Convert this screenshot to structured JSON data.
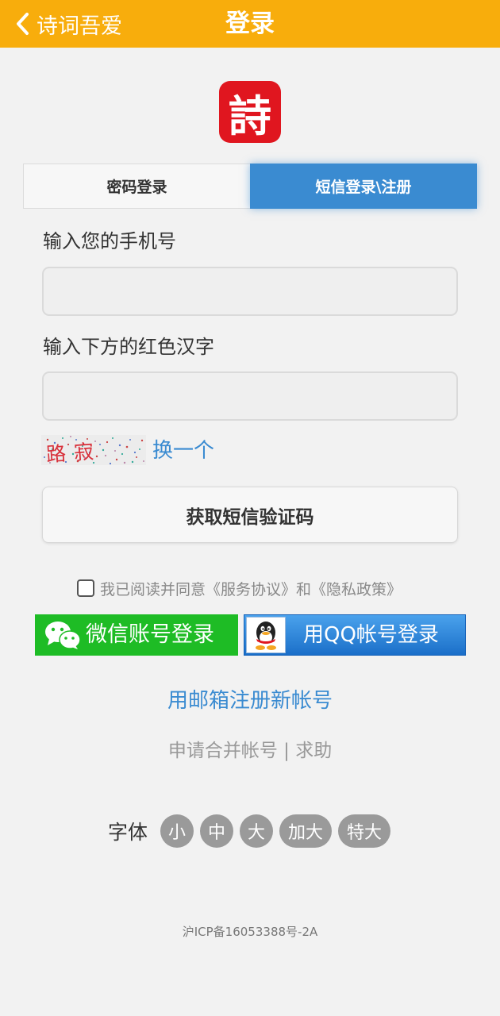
{
  "header": {
    "back_label": "诗词吾爱",
    "title": "登录"
  },
  "logo": {
    "char": "詩",
    "color": "#e0161f"
  },
  "tabs": [
    {
      "label": "密码登录",
      "active": false
    },
    {
      "label": "短信登录\\注册",
      "active": true
    }
  ],
  "form": {
    "phone_label": "输入您的手机号",
    "phone_value": "",
    "captcha_label": "输入下方的红色汉字",
    "captcha_value": "",
    "captcha_chars": "路寂",
    "refresh_label": "换一个",
    "sms_button": "获取短信验证码"
  },
  "agreement": {
    "checked": false,
    "text": "我已阅读并同意《服务协议》和《隐私政策》"
  },
  "social": {
    "wechat_label": "微信账号登录",
    "qq_label": "用QQ帐号登录"
  },
  "links": {
    "email_register": "用邮箱注册新帐号",
    "merge_account": "申请合并帐号",
    "separator": "|",
    "help": "求助"
  },
  "font_size": {
    "label": "字体",
    "options": [
      "小",
      "中",
      "大",
      "加大",
      "特大"
    ]
  },
  "footer": {
    "icp": "沪ICP备16053388号-2A"
  },
  "colors": {
    "header_bg": "#f8ad0c",
    "accent_blue": "#3a8bd1",
    "wechat_green": "#1ebc25",
    "qq_blue": "#1b6fc9"
  }
}
